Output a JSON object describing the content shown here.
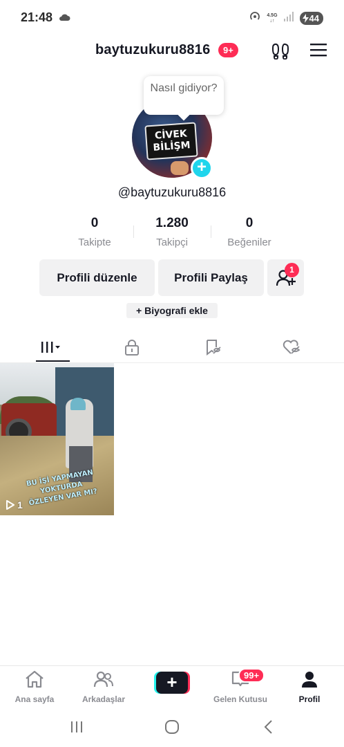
{
  "status_bar": {
    "time": "21:48",
    "network_top": "4.5G",
    "network_bottom": "↓↑",
    "battery": "44"
  },
  "header": {
    "username": "baytuzukuru8816",
    "notification_badge": "9+"
  },
  "profile": {
    "tooltip": "Nasıl gidiyor?",
    "avatar_sign_line1": "CİVEK",
    "avatar_sign_line2": "BİLİŞM",
    "handle": "@baytuzukuru8816"
  },
  "stats": [
    {
      "value": "0",
      "label": "Takipte"
    },
    {
      "value": "1.280",
      "label": "Takipçi"
    },
    {
      "value": "0",
      "label": "Beğeniler"
    }
  ],
  "actions": {
    "edit_profile": "Profili düzenle",
    "share_profile": "Profili Paylaş",
    "friend_badge": "1",
    "add_bio": "+ Biyografi ekle"
  },
  "tabs": [
    {
      "icon": "videos-grid-icon",
      "active": true
    },
    {
      "icon": "lock-icon",
      "active": false
    },
    {
      "icon": "saved-icon",
      "active": false
    },
    {
      "icon": "liked-icon",
      "active": false
    }
  ],
  "videos": [
    {
      "caption_line1": "BU İŞİ YAPMAYAN YOKTURDA",
      "caption_line2": "ÖZLEYEN VAR MI?",
      "views": "1"
    }
  ],
  "bottom_nav": {
    "home": "Ana sayfa",
    "friends": "Arkadaşlar",
    "inbox": "Gelen Kutusu",
    "inbox_badge": "99+",
    "profile": "Profil"
  },
  "colors": {
    "accent_red": "#fe2c55",
    "accent_cyan": "#20d5ec",
    "text_primary": "#161823",
    "text_secondary": "#8a8b91",
    "button_bg": "#f1f1f2"
  }
}
